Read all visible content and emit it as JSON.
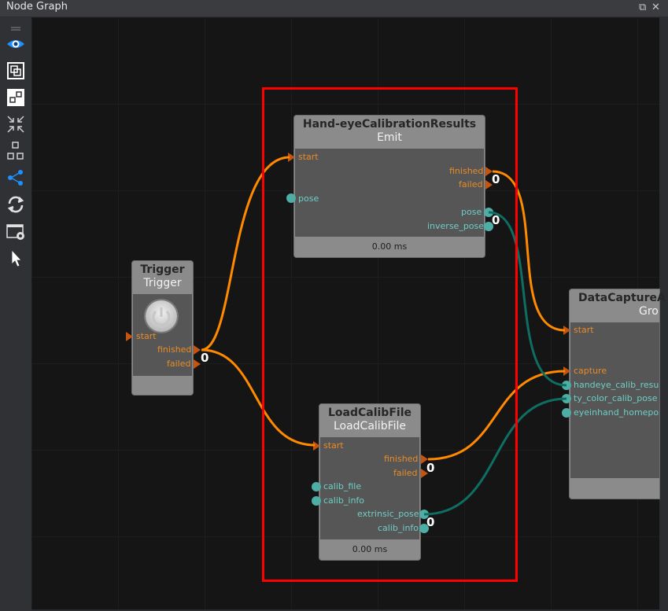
{
  "window": {
    "title": "Node Graph"
  },
  "toolbar": {
    "icons": [
      "drag-handle",
      "eye",
      "frame",
      "node-link",
      "collapse",
      "group",
      "share",
      "refresh",
      "screenshot",
      "pointer"
    ],
    "accent": "#1e90ff"
  },
  "colors": {
    "exec": "#e88b26",
    "data": "#6ecdc5",
    "wire_exec": "#ff8a00",
    "wire_data": "#0f6e63",
    "highlight": "#ff0000"
  },
  "nodes": {
    "trigger": {
      "title": "Trigger",
      "subtitle": "Trigger",
      "inputs": [
        {
          "label": "start"
        }
      ],
      "outputs": [
        {
          "label": "finished"
        },
        {
          "label": "failed"
        }
      ],
      "failed_count": "0"
    },
    "handeye": {
      "title": "Hand-eyeCalibrationResults",
      "subtitle": "Emit",
      "inputs": [
        {
          "label": "start"
        },
        {
          "label": "pose"
        }
      ],
      "outputs": [
        {
          "label": "finished"
        },
        {
          "label": "failed"
        },
        {
          "label": "pose"
        },
        {
          "label": "inverse_pose"
        }
      ],
      "failed_count": "0",
      "pose_count": "0",
      "timing": "0.00 ms"
    },
    "loadcalib": {
      "title": "LoadCalibFile",
      "subtitle": "LoadCalibFile",
      "inputs": [
        {
          "label": "start"
        },
        {
          "label": "calib_file"
        },
        {
          "label": "calib_info"
        }
      ],
      "outputs": [
        {
          "label": "finished"
        },
        {
          "label": "failed"
        },
        {
          "label": "extrinsic_pose"
        },
        {
          "label": "calib_info"
        }
      ],
      "failed_count": "0",
      "pose_count": "0",
      "timing": "0.00 ms"
    },
    "datacapture": {
      "title": "DataCaptureA",
      "subtitle": "Gro",
      "inputs": [
        {
          "label": "start"
        },
        {
          "label": "capture"
        },
        {
          "label": "handeye_calib_result"
        },
        {
          "label": "ty_color_calib_pose"
        },
        {
          "label": "eyeinhand_homepos"
        }
      ]
    }
  }
}
